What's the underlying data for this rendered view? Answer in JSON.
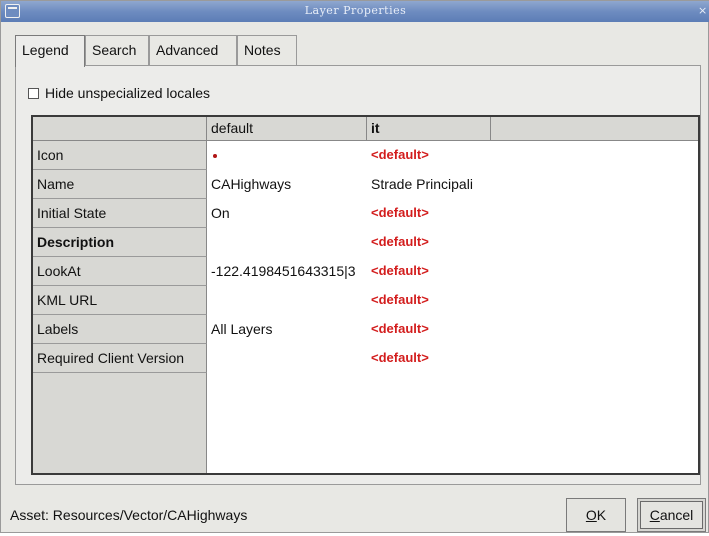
{
  "window": {
    "title": "Layer Properties",
    "close_glyph": "×",
    "icon": "window-menu-icon"
  },
  "tabs": [
    {
      "label": "Legend",
      "active": true
    },
    {
      "label": "Search",
      "active": false
    },
    {
      "label": "Advanced",
      "active": false
    },
    {
      "label": "Notes",
      "active": false
    }
  ],
  "hide_unspecialized": {
    "label": "Hide unspecialized locales",
    "checked": false
  },
  "table": {
    "columns": [
      "default",
      "it"
    ],
    "rows": [
      {
        "label": "Icon",
        "bold": false,
        "default": "",
        "it": "<default>"
      },
      {
        "label": "Name",
        "bold": false,
        "default": "CAHighways",
        "it": "Strade Principali"
      },
      {
        "label": "Initial State",
        "bold": false,
        "default": "On",
        "it": "<default>"
      },
      {
        "label": "Description",
        "bold": true,
        "default": "",
        "it": "<default>"
      },
      {
        "label": "LookAt",
        "bold": false,
        "default": "-122.4198451643315|3",
        "it": "<default>"
      },
      {
        "label": "KML URL",
        "bold": false,
        "default": "",
        "it": "<default>"
      },
      {
        "label": "Labels",
        "bold": false,
        "default": "All Layers",
        "it": "<default>"
      },
      {
        "label": "Required Client Version",
        "bold": false,
        "default": "",
        "it": "<default>"
      }
    ],
    "red_color": "#d31d1d",
    "icon_swatch_color": "#b01515"
  },
  "status": {
    "text": "Asset: Resources/Vector/CAHighways"
  },
  "buttons": {
    "ok_prefix": "",
    "ok_mnemonic": "O",
    "ok_rest": "K",
    "cancel_mnemonic": "C",
    "cancel_rest": "ancel"
  }
}
